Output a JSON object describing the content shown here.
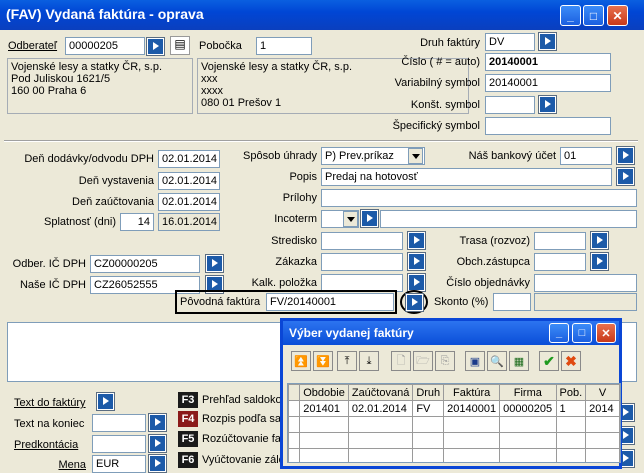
{
  "window": {
    "title": "(FAV) Vydaná faktúra - oprava",
    "min": "_",
    "max": "□",
    "close": "✕"
  },
  "odberatel": {
    "label": "Odberateľ",
    "value": "00000205",
    "address": [
      "Vojenské lesy a statky ČR, s.p.",
      "Pod Juliskou 1621/5",
      "160 00 Praha 6"
    ]
  },
  "pobocka": {
    "label": "Pobočka",
    "value": "1",
    "address": [
      "Vojenské lesy a statky ČR, s.p.",
      "xxx",
      "xxxx",
      "080 01 Prešov 1"
    ]
  },
  "druh": {
    "label": "Druh faktúry",
    "value": "DV"
  },
  "cislo": {
    "label": "Číslo ( # = auto)",
    "value": "20140001"
  },
  "vs": {
    "label": "Variabilný symbol",
    "value": "20140001"
  },
  "ks": {
    "label": "Konšt. symbol",
    "value": ""
  },
  "ss": {
    "label": "Špecifický symbol",
    "value": ""
  },
  "dates": {
    "dodavky_label": "Deň dodávky/odvodu DPH",
    "dodavky": "02.01.2014",
    "vystavenia_label": "Deň vystavenia",
    "vystavenia": "02.01.2014",
    "zauctovania_label": "Deň zaúčtovania",
    "zauctovania": "02.01.2014",
    "splatnost_label": "Splatnosť (dni)",
    "splatnost_dni": "14",
    "splatnost": "16.01.2014"
  },
  "uhrada": {
    "label": "Spôsob úhrady",
    "value": "P) Prev.príkaz"
  },
  "ucet": {
    "label": "Náš bankový účet",
    "value": "01"
  },
  "popis": {
    "label": "Popis",
    "value": "Predaj na hotovosť"
  },
  "prilohy": {
    "label": "Prílohy"
  },
  "incoterm": {
    "label": "Incoterm"
  },
  "stredisko": {
    "label": "Stredisko"
  },
  "zakazka": {
    "label": "Zákazka"
  },
  "kalk": {
    "label": "Kalk. položka"
  },
  "trasa": {
    "label": "Trasa (rozvoz)"
  },
  "obch": {
    "label": "Obch.zástupca"
  },
  "objednavka": {
    "label": "Číslo objednávky"
  },
  "skonto": {
    "label": "Skonto (%)"
  },
  "odber_ic": {
    "label": "Odber. IČ DPH",
    "value": "CZ00000205"
  },
  "nase_ic": {
    "label": "Naše IČ DPH",
    "value": "CZ26052555"
  },
  "povodna": {
    "label": "Pôvodná faktúra",
    "value": "FV/20140001"
  },
  "bottom": {
    "text_do": "Text do faktúry",
    "text_na": "Text na koniec",
    "predkont": "Predkontácia",
    "mena_label": "Mena",
    "mena": "EUR",
    "fkeys": [
      {
        "key": "F3",
        "label": "Prehľad saldoko"
      },
      {
        "key": "F4",
        "label": "Rozpis podľa sa"
      },
      {
        "key": "F5",
        "label": "Rozúčtovanie fa"
      },
      {
        "key": "F6",
        "label": "Vyúčtovanie zálo"
      }
    ]
  },
  "popup": {
    "title": "Výber vydanej faktúry",
    "columns": [
      "Obdobie",
      "Zaúčtovaná",
      "Druh",
      "Faktúra",
      "Firma",
      "Pob.",
      "V"
    ],
    "rows": [
      [
        "201401",
        "02.01.2014",
        "FV",
        "20140001",
        "00000205",
        "1",
        "2014"
      ]
    ]
  }
}
